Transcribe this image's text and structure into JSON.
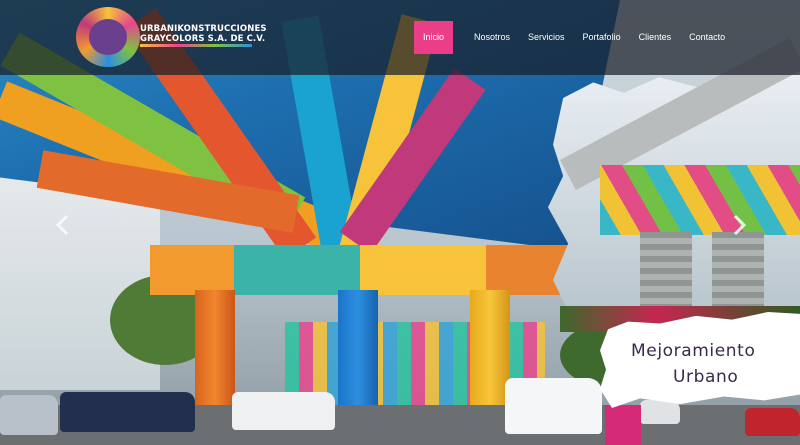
{
  "brand": {
    "name_line1": "URBANIKONSTRUCCIONES",
    "name_line2": "GRAYCOLORS S.A. DE C.V."
  },
  "nav": {
    "items": [
      {
        "label": "Inicio",
        "active": true
      },
      {
        "label": "Nosotros",
        "active": false
      },
      {
        "label": "Servicios",
        "active": false
      },
      {
        "label": "Portafolio",
        "active": false
      },
      {
        "label": "Clientes",
        "active": false
      },
      {
        "label": "Contacto",
        "active": false
      }
    ]
  },
  "hero": {
    "caption_line1": "Mejoramiento",
    "caption_line2": "Urbano"
  },
  "carousel": {
    "prev_icon": "chevron-left-icon",
    "next_icon": "chevron-right-icon"
  },
  "colors": {
    "header_bg": "#191e28",
    "nav_active": "#ea3f88",
    "caption_text": "#3a2a4c"
  }
}
